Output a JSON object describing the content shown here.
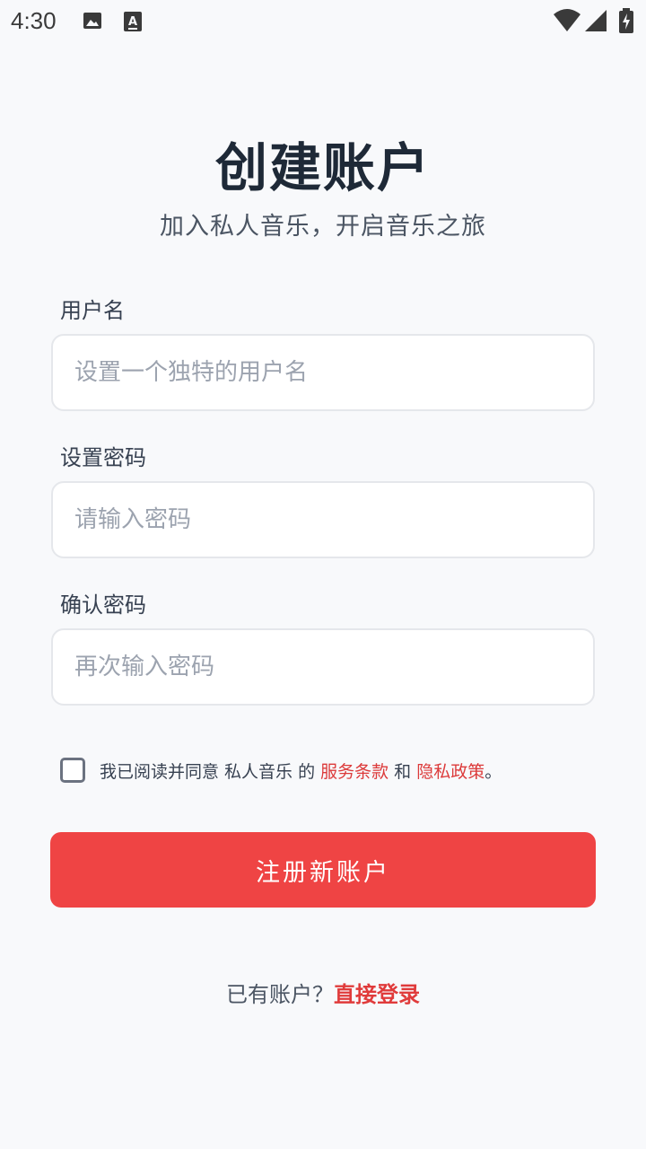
{
  "status_bar": {
    "time": "4:30",
    "icons": [
      "image-icon",
      "text-a-icon",
      "wifi-icon",
      "signal-icon",
      "battery-charging-icon"
    ]
  },
  "header": {
    "title": "创建账户",
    "subtitle": "加入私人音乐，开启音乐之旅"
  },
  "form": {
    "username": {
      "label": "用户名",
      "value": "",
      "placeholder": "设置一个独特的用户名"
    },
    "password": {
      "label": "设置密码",
      "value": "",
      "placeholder": "请输入密码"
    },
    "confirm_password": {
      "label": "确认密码",
      "value": "",
      "placeholder": "再次输入密码"
    }
  },
  "agreement": {
    "checked": false,
    "prefix": "我已阅读并同意 私人音乐 的 ",
    "terms_link": "服务条款",
    "conjunction": " 和 ",
    "privacy_link": "隐私政策",
    "suffix": "。"
  },
  "register_button": {
    "label": "注册新账户"
  },
  "footer": {
    "prompt": "已有账户？",
    "login_link": "直接登录"
  },
  "colors": {
    "accent": "#ef4444",
    "background": "#f8f9fb",
    "title": "#1e2937"
  }
}
